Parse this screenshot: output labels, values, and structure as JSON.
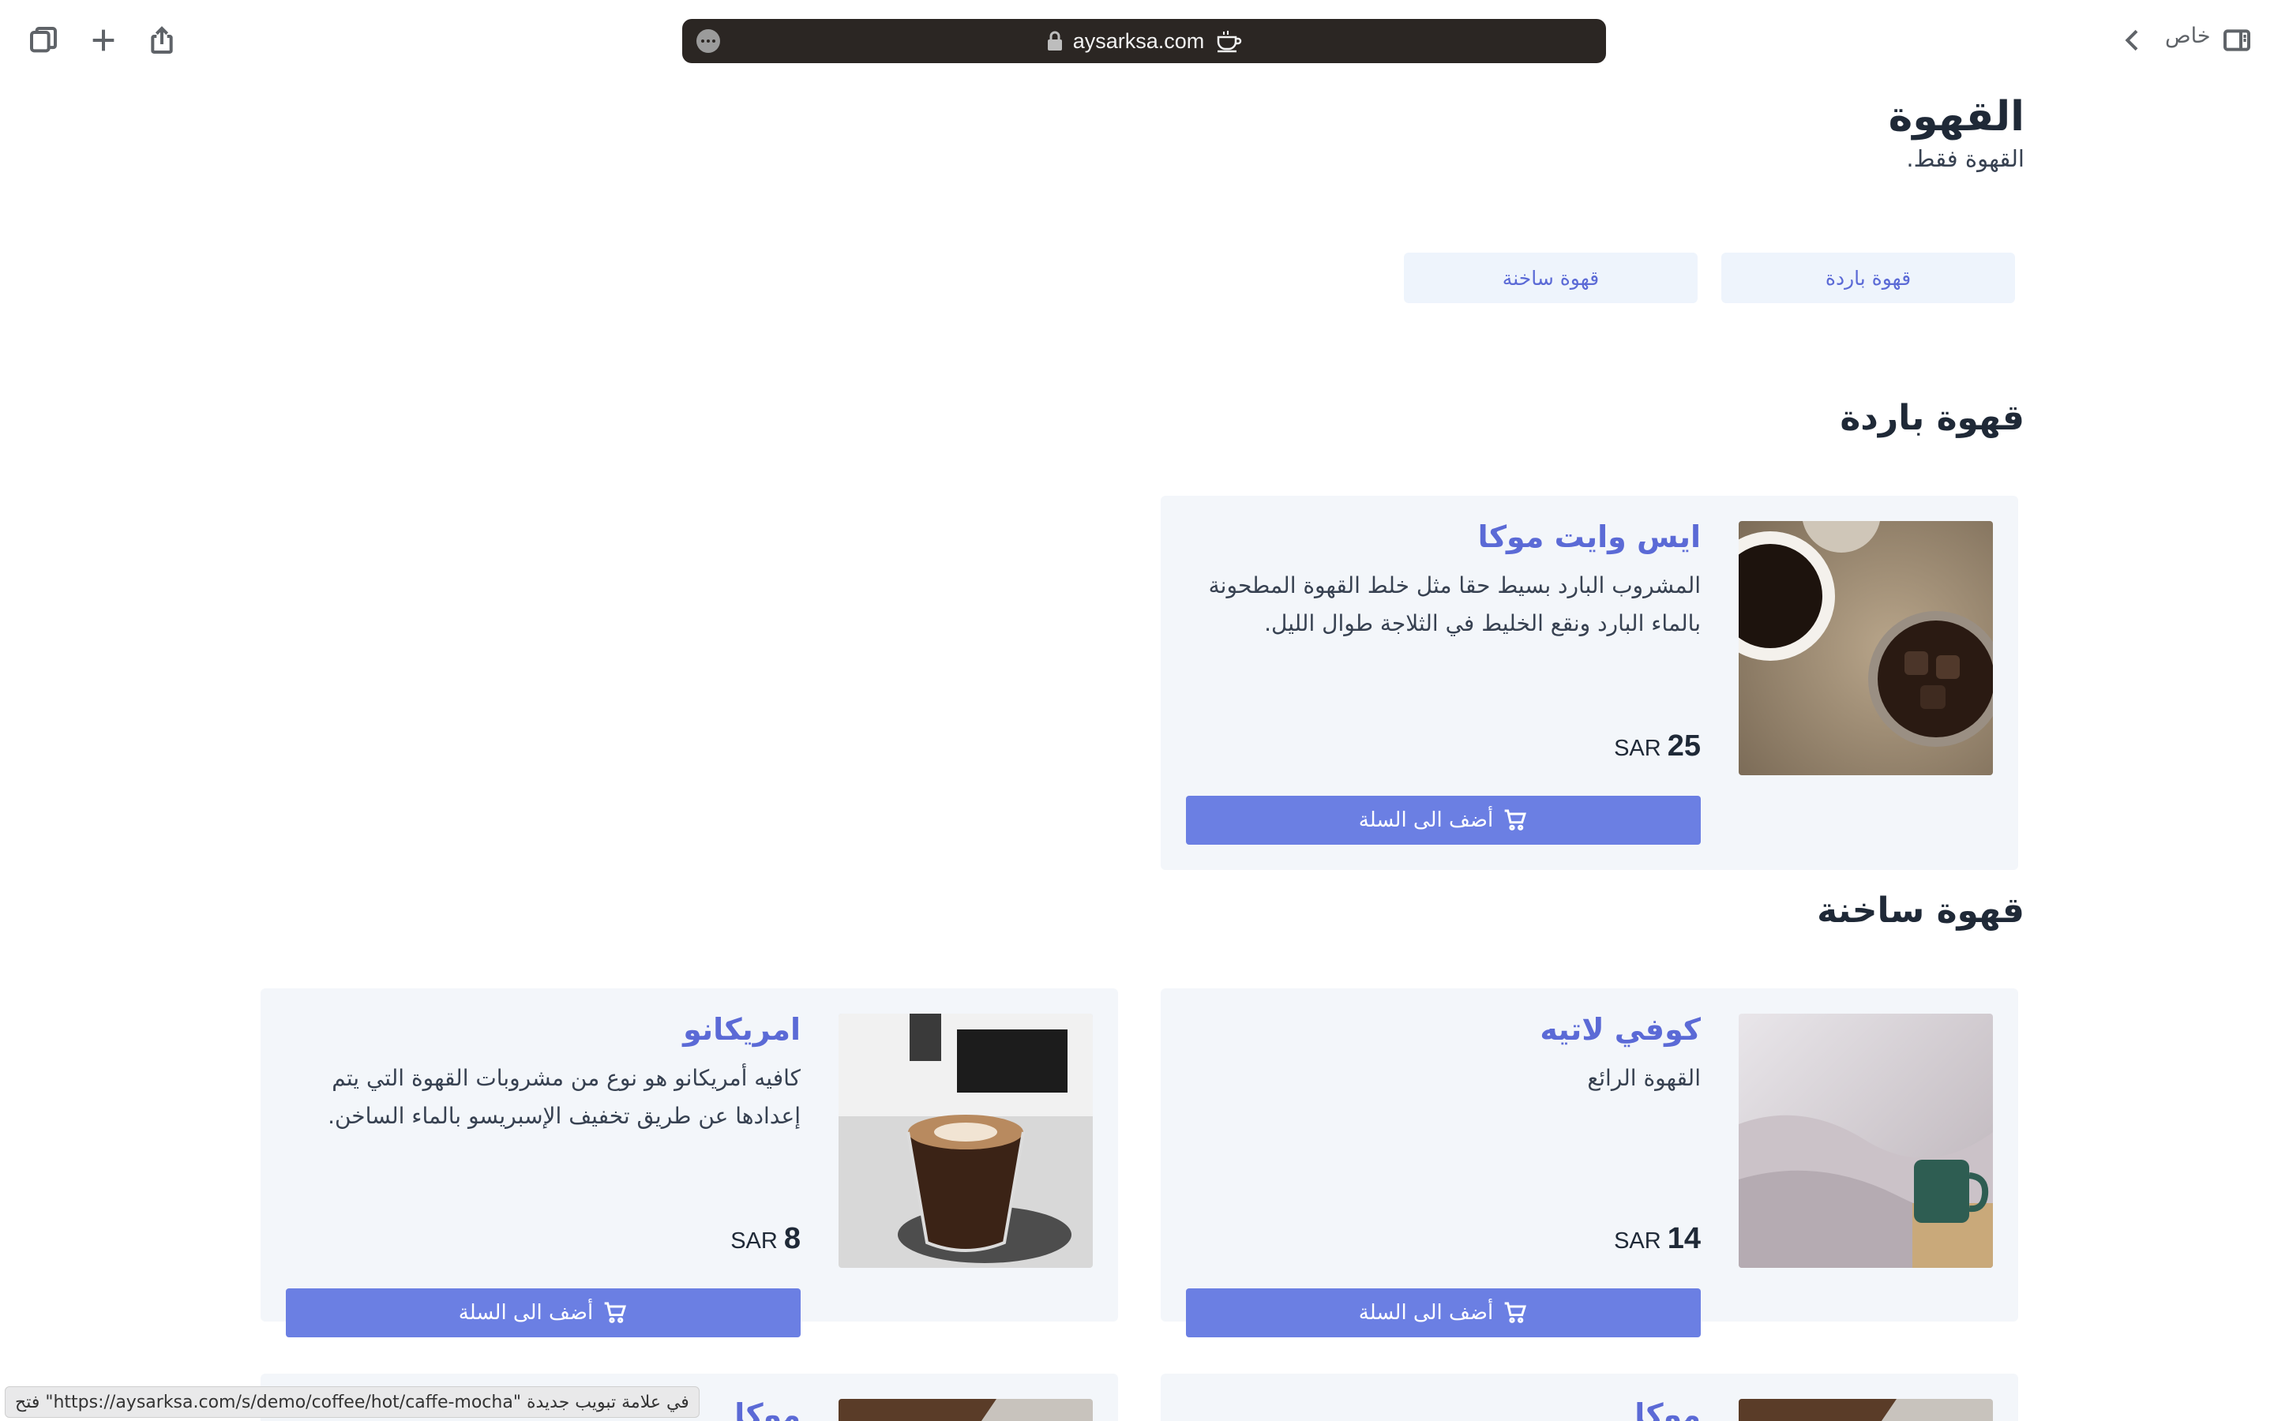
{
  "browser": {
    "url_text": "aysarksa.com",
    "private_label": "خاص"
  },
  "page": {
    "title": "القهوة",
    "subtitle": "القهوة فقط."
  },
  "categories": [
    {
      "label": "قهوة باردة"
    },
    {
      "label": "قهوة ساخنة"
    }
  ],
  "sections": [
    {
      "title": "قهوة باردة"
    },
    {
      "title": "قهوة ساخنة"
    }
  ],
  "products": [
    {
      "name": "ايس وايت موكا",
      "description": "المشروب البارد بسيط حقا مثل خلط القهوة المطحونة بالماء البارد ونقع الخليط في الثلاجة طوال الليل.",
      "price": "25",
      "currency": "SAR",
      "button": "أضف الى السلة"
    },
    {
      "name": "كوفي لاتيه",
      "description": "القهوة الرائع",
      "price": "14",
      "currency": "SAR",
      "button": "أضف الى السلة"
    },
    {
      "name": "امريكانو",
      "description": "كافيه أمريكانو هو نوع من مشروبات القهوة التي يتم إعدادها عن طريق تخفيف الإسبريسو بالماء الساخن.",
      "price": "8",
      "currency": "SAR",
      "button": "أضف الى السلة"
    },
    {
      "name": "موكا"
    },
    {
      "name": "موكا"
    }
  ],
  "status_bar": {
    "text": "فتح \"https://aysarksa.com/s/demo/coffee/hot/caffe-mocha\" في علامة تبويب جديدة"
  },
  "colors": {
    "accent": "#5b6ad6",
    "button": "#6b7fe3",
    "card_bg": "#f3f6fa",
    "tab_bg": "#eef4fc",
    "url_bar": "#2b2623"
  }
}
